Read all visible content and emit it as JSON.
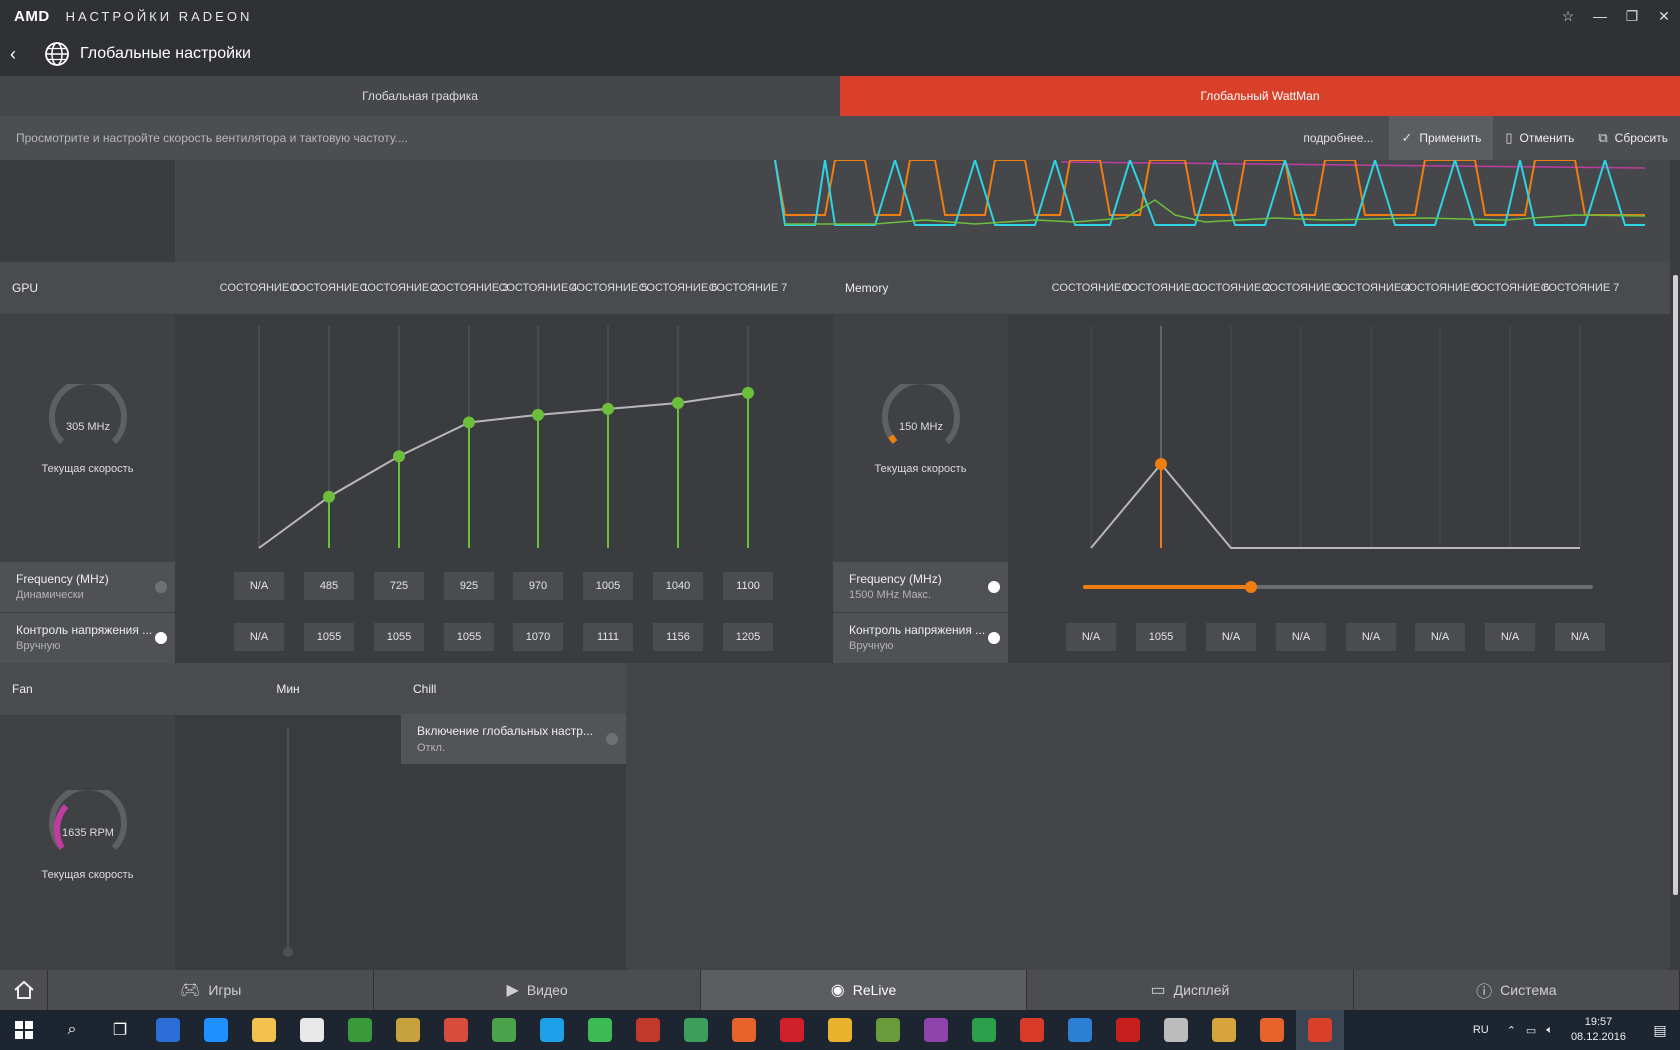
{
  "titlebar": {
    "logo": "AMD",
    "app_title": "НАСТРОЙКИ RADEON"
  },
  "header": {
    "title": "Глобальные настройки"
  },
  "tabs": [
    {
      "label": "Глобальная графика",
      "active": false
    },
    {
      "label": "Глобальный WattMan",
      "active": true
    }
  ],
  "infobar": {
    "text": "Просмотрите и настройте скорость вентилятора и тактовую частоту....",
    "more": "подробнее...",
    "apply": "Применить",
    "cancel": "Отменить",
    "reset": "Сбросить"
  },
  "gpu": {
    "label": "GPU",
    "gauge_value": "305 MHz",
    "gauge_caption": "Текущая скорость",
    "states": [
      "СОСТОЯНИЕ 0",
      "СОСТОЯНИЕ 1",
      "СОСТОЯНИЕ 2",
      "СОСТОЯНИЕ 3",
      "СОСТОЯНИЕ 4",
      "СОСТОЯНИЕ 5",
      "СОСТОЯНИЕ 6",
      "СОСТОЯНИЕ 7"
    ],
    "frequency": {
      "title": "Frequency (MHz)",
      "mode": "Динамически",
      "values": [
        "N/A",
        "485",
        "725",
        "925",
        "970",
        "1005",
        "1040",
        "1100"
      ]
    },
    "voltage": {
      "title": "Контроль напряжения ...",
      "mode": "Вручную",
      "values": [
        "N/A",
        "1055",
        "1055",
        "1055",
        "1070",
        "1111",
        "1156",
        "1205"
      ]
    }
  },
  "memory": {
    "label": "Memory",
    "gauge_value": "150 MHz",
    "gauge_caption": "Текущая скорость",
    "states": [
      "СОСТОЯНИЕ 0",
      "СОСТОЯНИЕ 1",
      "СОСТОЯНИЕ 2",
      "СОСТОЯНИЕ 3",
      "СОСТОЯНИЕ 4",
      "СОСТОЯНИЕ 5",
      "СОСТОЯНИЕ 6",
      "СОСТОЯНИЕ 7"
    ],
    "frequency": {
      "title": "Frequency (MHz)",
      "mode": "1500 MHz Макс.",
      "slider_fraction": 0.33
    },
    "voltage": {
      "title": "Контроль напряжения ...",
      "mode": "Вручную",
      "values": [
        "N/A",
        "1055",
        "N/A",
        "N/A",
        "N/A",
        "N/A",
        "N/A",
        "N/A"
      ]
    }
  },
  "fan": {
    "label": "Fan",
    "min_label": "Мин",
    "gauge_value": "1635 RPM",
    "gauge_caption": "Текущая скорость"
  },
  "chill": {
    "label": "Chill",
    "item_title": "Включение глобальных настр...",
    "item_state": "Откл."
  },
  "bottomnav": [
    {
      "label": "Игры",
      "icon": "gamepad-icon",
      "active": false
    },
    {
      "label": "Видео",
      "icon": "play-icon",
      "active": false
    },
    {
      "label": "ReLive",
      "icon": "relive-icon",
      "active": true
    },
    {
      "label": "Дисплей",
      "icon": "monitor-icon",
      "active": false
    },
    {
      "label": "Система",
      "icon": "info-icon",
      "active": false
    }
  ],
  "taskbar": {
    "lang": "RU",
    "time": "19:57",
    "date": "08.12.2016"
  },
  "colors": {
    "accent": "#d8402a",
    "gpu_green": "#6cbf3b",
    "mem_orange": "#f07d12",
    "fan_magenta": "#c03ca0"
  }
}
